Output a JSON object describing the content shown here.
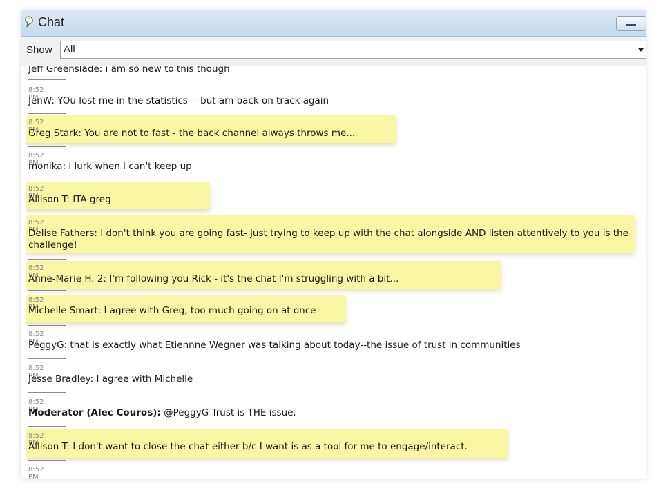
{
  "window": {
    "title": "Chat"
  },
  "colors": {
    "highlight": "#f9f7a3",
    "titlebar": "#c6d9ee",
    "timestamp": "#8a8a8a"
  },
  "filter": {
    "label": "Show",
    "selected": "All"
  },
  "messages": [
    {
      "time": "",
      "sender": "",
      "text": "Jeff Greenslade: i am so new to this though"
    },
    {
      "time": "8:52 PM",
      "sender": "",
      "text": "JenW: YOu lost me in the statistics -- but am back on track again"
    },
    {
      "time": "8:52 PM",
      "sender": "",
      "text": "Greg Stark: You are not to fast - the back channel always throws me...",
      "highlighted": true
    },
    {
      "time": "8:52 PM",
      "sender": "",
      "text": "monika: i lurk when i can't keep up"
    },
    {
      "time": "8:52 PM",
      "sender": "",
      "text": "Allison T: ITA greg",
      "highlighted": true
    },
    {
      "time": "8:52 PM",
      "sender": "",
      "text": "Delise Fathers: I don't think you are going fast- just trying to keep up with the chat alongside AND listen attentively to you is the challenge!",
      "highlighted": true
    },
    {
      "time": "8:52 PM",
      "sender": "",
      "text": "Anne-Marie H. 2: I'm following you Rick - it's the chat I'm struggling with a bit...",
      "highlighted": true
    },
    {
      "time": "8:52 PM",
      "sender": "",
      "text": "Michelle Smart: I agree with Greg, too much going on at once",
      "highlighted": true
    },
    {
      "time": "8:52 PM",
      "sender": "",
      "text": "PeggyG: that is exactly what Etiennne Wegner was talking about today--the issue of trust in communities"
    },
    {
      "time": "8:52 PM",
      "sender": "",
      "text": "Jesse Bradley: I agree with Michelle"
    },
    {
      "time": "8:52 PM",
      "sender": "Moderator (Alec Couros):",
      "text": " @PeggyG Trust is THE issue."
    },
    {
      "time": "8:52 PM",
      "sender": "",
      "text": "Allison T: I don't want to close the chat either b/c I want is as a tool for me to engage/interact.",
      "highlighted": true
    },
    {
      "time": "8:52 PM",
      "sender": "",
      "text": ""
    }
  ]
}
